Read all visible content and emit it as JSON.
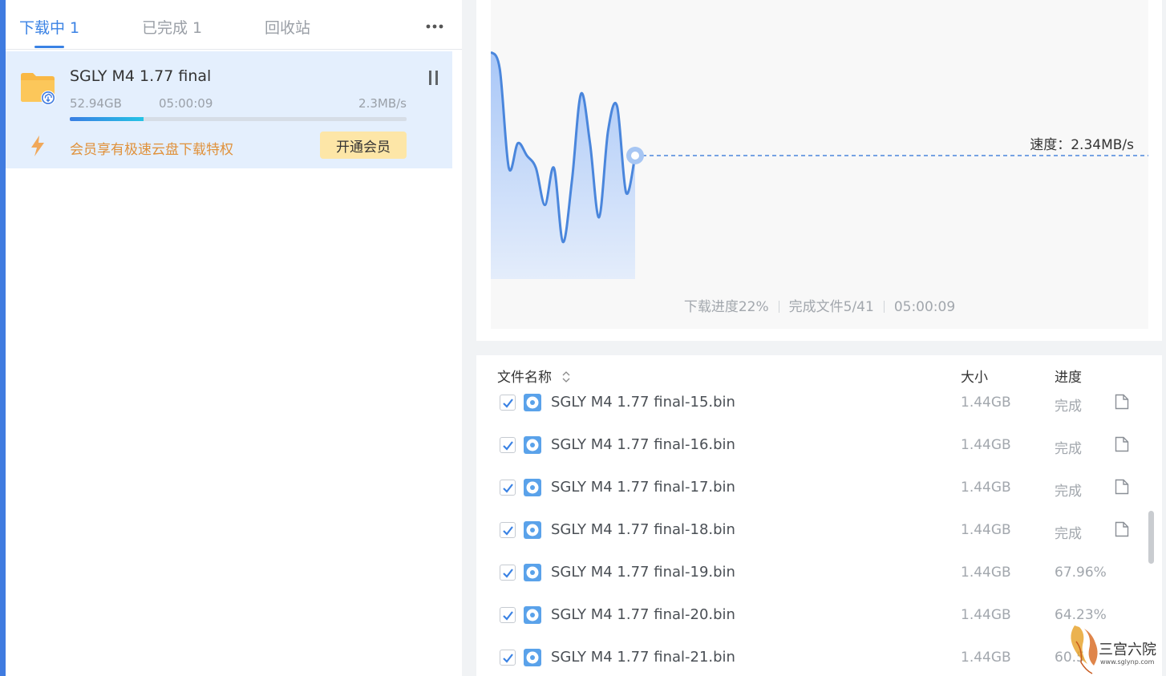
{
  "tabs": [
    {
      "label": "下载中",
      "count": "1"
    },
    {
      "label": "已完成",
      "count": "1"
    },
    {
      "label": "回收站"
    }
  ],
  "task": {
    "name": "SGLY M4 1.77 final",
    "size": "52.94GB",
    "time": "05:00:09",
    "speed": "2.3MB/s",
    "progress": 0.22,
    "vip_text": "会员享有极速云盘下载特权",
    "vip_button": "开通会员"
  },
  "chart": {
    "speed_label": "速度：2.34MB/s",
    "progress_text": "下载进度22%",
    "files_text": "完成文件5/41",
    "time_text": "05:00:09"
  },
  "chart_data": {
    "type": "area",
    "y_relative": [
      0.92,
      0.85,
      0.45,
      0.55,
      0.5,
      0.45,
      0.3,
      0.45,
      0.15,
      0.4,
      0.75,
      0.55,
      0.25,
      0.6,
      0.7,
      0.35,
      0.5
    ],
    "current_relative": 0.5
  },
  "files": {
    "header": {
      "name": "文件名称",
      "size": "大小",
      "progress": "进度"
    },
    "rows": [
      {
        "name": "SGLY M4 1.77 final-15.bin",
        "size": "1.44GB",
        "progress": "完成"
      },
      {
        "name": "SGLY M4 1.77 final-16.bin",
        "size": "1.44GB",
        "progress": "完成"
      },
      {
        "name": "SGLY M4 1.77 final-17.bin",
        "size": "1.44GB",
        "progress": "完成"
      },
      {
        "name": "SGLY M4 1.77 final-18.bin",
        "size": "1.44GB",
        "progress": "完成"
      },
      {
        "name": "SGLY M4 1.77 final-19.bin",
        "size": "1.44GB",
        "progress": "67.96%"
      },
      {
        "name": "SGLY M4 1.77 final-20.bin",
        "size": "1.44GB",
        "progress": "64.23%"
      },
      {
        "name": "SGLY M4 1.77 final-21.bin",
        "size": "1.44GB",
        "progress": "60.5"
      }
    ]
  },
  "watermark": {
    "text": "三宫六院",
    "url": "www.sglynp.com"
  },
  "colors": {
    "accent": "#3a82e4",
    "vip": "#e0913a",
    "vip_bg": "#fde6a7",
    "task_bg": "#e4effd"
  }
}
